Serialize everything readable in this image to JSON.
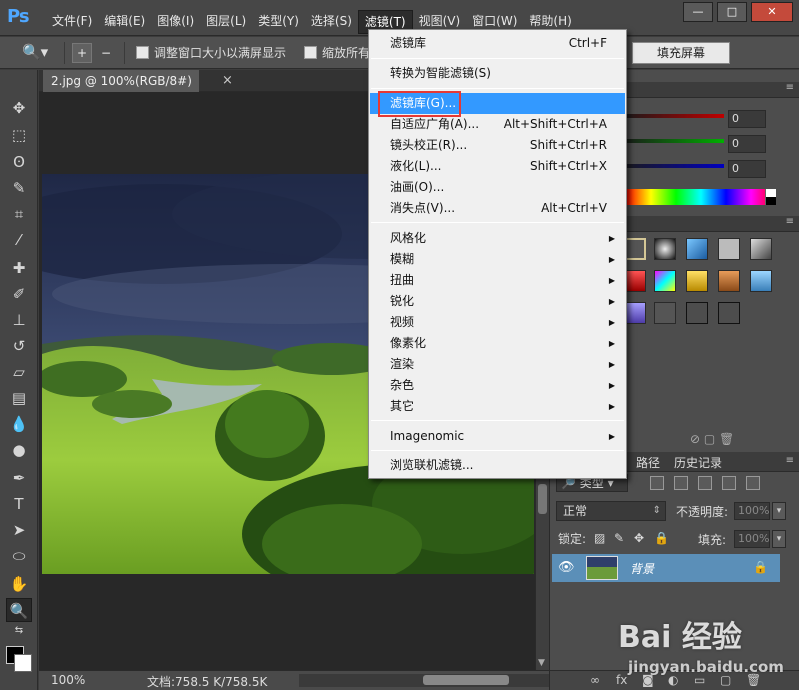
{
  "app": {
    "logo": "Ps"
  },
  "menubar": {
    "items": [
      "文件(F)",
      "编辑(E)",
      "图像(I)",
      "图层(L)",
      "类型(Y)",
      "选择(S)",
      "滤镜(T)",
      "视图(V)",
      "窗口(W)",
      "帮助(H)"
    ],
    "active_index": 6,
    "window_buttons": [
      "—",
      "□",
      "✕"
    ]
  },
  "options_bar": {
    "check1_label": "调整窗口大小以满屏显示",
    "check2_label": "缩放所有",
    "fill_screen_label": "填充屏幕"
  },
  "document": {
    "tab_label": "2.jpg @ 100%(RGB/8#)",
    "tab_close": "×",
    "zoom": "100%",
    "doc_info": "文档:758.5 K/758.5K"
  },
  "filter_menu": {
    "items": [
      {
        "label": "滤镜库",
        "shortcut": "Ctrl+F"
      },
      {
        "label": "转换为智能滤镜(S)",
        "shortcut": ""
      },
      {
        "label": "滤镜库(G)...",
        "shortcut": "",
        "highlighted": true
      },
      {
        "label": "自适应广角(A)...",
        "shortcut": "Alt+Shift+Ctrl+A"
      },
      {
        "label": "镜头校正(R)...",
        "shortcut": "Shift+Ctrl+R"
      },
      {
        "label": "液化(L)...",
        "shortcut": "Shift+Ctrl+X"
      },
      {
        "label": "油画(O)...",
        "shortcut": ""
      },
      {
        "label": "消失点(V)...",
        "shortcut": "Alt+Ctrl+V"
      },
      {
        "label": "风格化",
        "submenu": true
      },
      {
        "label": "模糊",
        "submenu": true
      },
      {
        "label": "扭曲",
        "submenu": true
      },
      {
        "label": "锐化",
        "submenu": true
      },
      {
        "label": "视频",
        "submenu": true
      },
      {
        "label": "像素化",
        "submenu": true
      },
      {
        "label": "渲染",
        "submenu": true
      },
      {
        "label": "杂色",
        "submenu": true
      },
      {
        "label": "其它",
        "submenu": true
      },
      {
        "label": "Imagenomic",
        "submenu": true
      },
      {
        "label": "浏览联机滤镜...",
        "shortcut": ""
      }
    ]
  },
  "color_panel": {
    "r_value": "0",
    "g_value": "0",
    "b_value": "0",
    "slider_colors": [
      "#c00000",
      "#00b000",
      "#0000c0"
    ]
  },
  "layers_panel": {
    "tabs": [
      "路径",
      "历史记录"
    ],
    "kind_label": "类型",
    "blend_mode": "正常",
    "opacity_label": "不透明度:",
    "opacity_value": "100%",
    "lock_label": "锁定:",
    "fill_label": "填充:",
    "fill_value": "100%",
    "layer_name": "背景"
  },
  "watermark": {
    "main": "Bai 经验",
    "sub": "jingyan.baidu.com"
  },
  "colors": {
    "menu_highlight": "#3399ff",
    "annotation_red": "#e53935",
    "ps_blue": "#4fa7ff"
  }
}
